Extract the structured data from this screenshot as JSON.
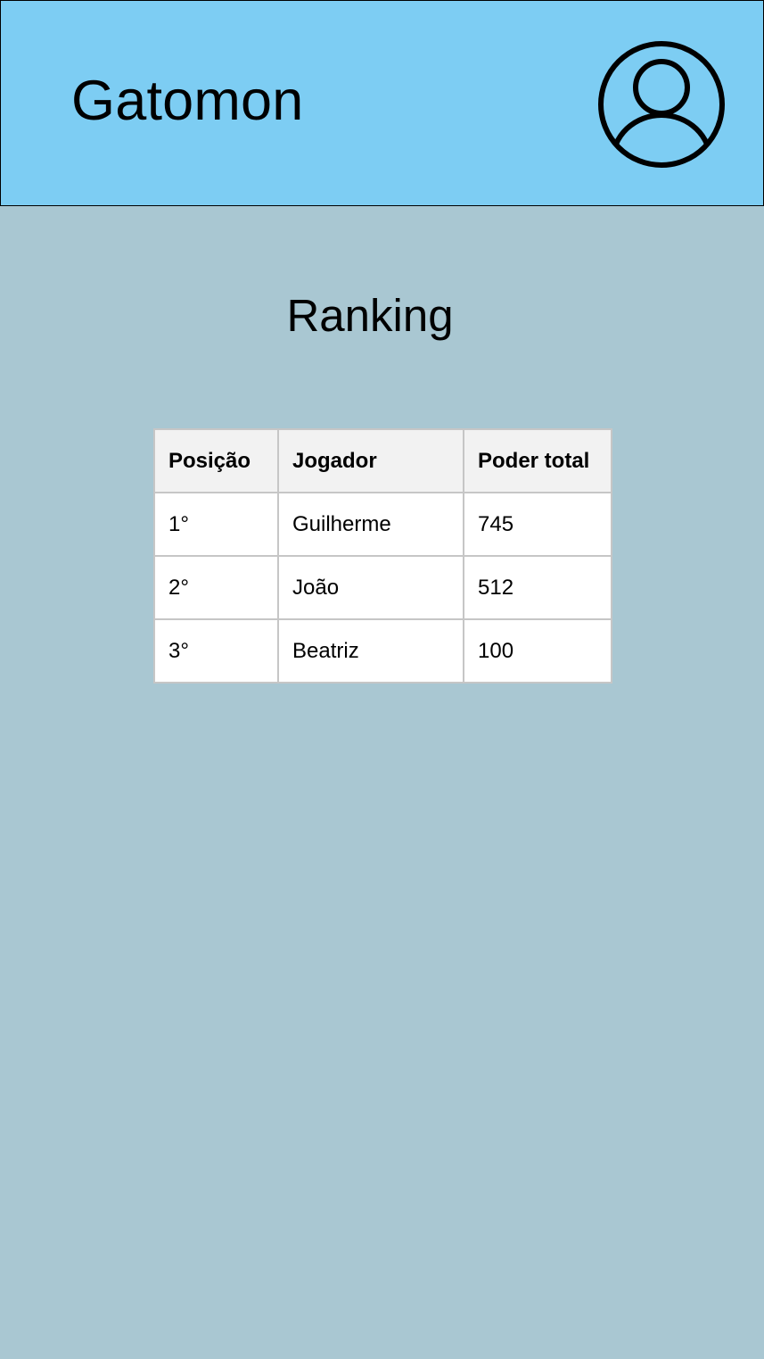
{
  "header": {
    "app_title": "Gatomon",
    "profile_icon": "user-circle-icon",
    "background_color": "#7dcdf3"
  },
  "main": {
    "background_color": "#a9c7d2",
    "title": "Ranking",
    "table": {
      "columns": [
        "Posição",
        "Jogador",
        "Poder total"
      ],
      "rows": [
        [
          "1°",
          "Guilherme",
          "745"
        ],
        [
          "2°",
          "João",
          "512"
        ],
        [
          "3°",
          "Beatriz",
          "100"
        ]
      ]
    }
  }
}
